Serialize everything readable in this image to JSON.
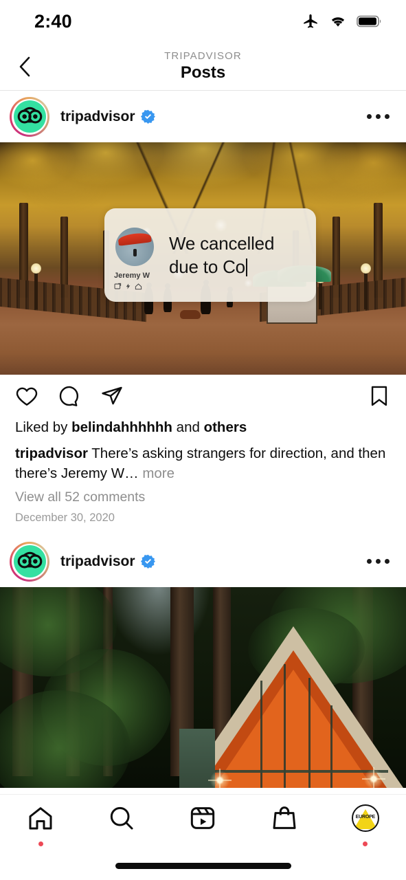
{
  "status_bar": {
    "time": "2:40",
    "icons": [
      "airplane-mode-icon",
      "wifi-icon",
      "battery-icon"
    ]
  },
  "header": {
    "back_icon": "chevron-left-icon",
    "eyebrow": "TRIPADVISOR",
    "title": "Posts"
  },
  "posts": [
    {
      "username": "tripadvisor",
      "verified": true,
      "avatar": "tripadvisor-owl-logo",
      "has_story_ring": true,
      "menu_icon": "more-options-icon",
      "media": {
        "alt": "autumn park mall lined with golden trees, people walking, food cart",
        "overlay_card": {
          "author": "Jeremy W",
          "avatar": "paraglider-photo",
          "text_line_1": "We cancelled",
          "text_line_2": "due to Co",
          "caret": true
        }
      },
      "actions": {
        "like": "heart-icon",
        "comment": "comment-icon",
        "share": "share-icon",
        "save": "bookmark-icon"
      },
      "likes_prefix": "Liked by ",
      "likes_user": "belindahhhhhh",
      "likes_middle": " and ",
      "likes_others": "others",
      "caption_user": "tripadvisor",
      "caption_text": " There’s asking strangers for direction, and then there’s Jeremy W… ",
      "caption_more": "more",
      "comments_link": "View all 52 comments",
      "date": "December 30, 2020"
    },
    {
      "username": "tripadvisor",
      "verified": true,
      "avatar": "tripadvisor-owl-logo",
      "has_story_ring": true,
      "menu_icon": "more-options-icon",
      "media": {
        "alt": "A-frame cabin glowing warm orange among tall redwood trees"
      }
    }
  ],
  "tab_bar": {
    "items": [
      {
        "name": "home",
        "icon": "home-icon",
        "badge_dot": true
      },
      {
        "name": "search",
        "icon": "search-icon",
        "badge_dot": false
      },
      {
        "name": "reels",
        "icon": "reels-icon",
        "badge_dot": false
      },
      {
        "name": "shop",
        "icon": "shop-bag-icon",
        "badge_dot": false
      },
      {
        "name": "profile",
        "icon": "profile-avatar",
        "badge_dot": true,
        "avatar_label": "EUROPE"
      }
    ]
  },
  "colors": {
    "accent_verified": "#3897f0",
    "badge_dot": "#ed4956",
    "brand_green": "#34e0a1",
    "muted_text": "#8e8e8e"
  }
}
